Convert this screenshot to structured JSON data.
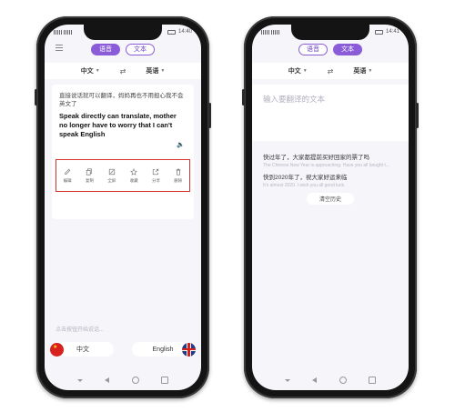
{
  "status": {
    "left_time": "14:40",
    "right_time": "14:41"
  },
  "header": {
    "voice_tab": "语音",
    "text_tab": "文本"
  },
  "langbar": {
    "source": "中文",
    "target": "英语"
  },
  "left": {
    "source_text": "直接说话就可以翻译，妈妈再也不用担心我不会英文了",
    "target_text": "Speak directly can translate, mother no longer have to worry that I can't speak English",
    "actions": [
      {
        "label": "编辑",
        "icon": "edit-icon"
      },
      {
        "label": "复制",
        "icon": "copy-icon"
      },
      {
        "label": "全屏",
        "icon": "fullscreen-icon"
      },
      {
        "label": "收藏",
        "icon": "star-icon"
      },
      {
        "label": "分享",
        "icon": "share-icon"
      },
      {
        "label": "删除",
        "icon": "trash-icon"
      }
    ],
    "hold_hint": "点击按钮开始说话...",
    "bottom_left_lang": "中文",
    "bottom_right_lang": "English"
  },
  "right": {
    "placeholder": "输入要翻译的文本",
    "history": [
      {
        "src": "快过年了，大家都提前买好回家的票了吗",
        "tgt": "The Chinese New Year is approaching. Have you all bought t..."
      },
      {
        "src": "快到2020年了，祝大家好运来临",
        "tgt": "It's almost 2020. I wish you all good luck."
      }
    ],
    "clear_label": "清空历史"
  },
  "colors": {
    "accent": "#8a5cd8",
    "highlight_border": "#d8332a"
  }
}
